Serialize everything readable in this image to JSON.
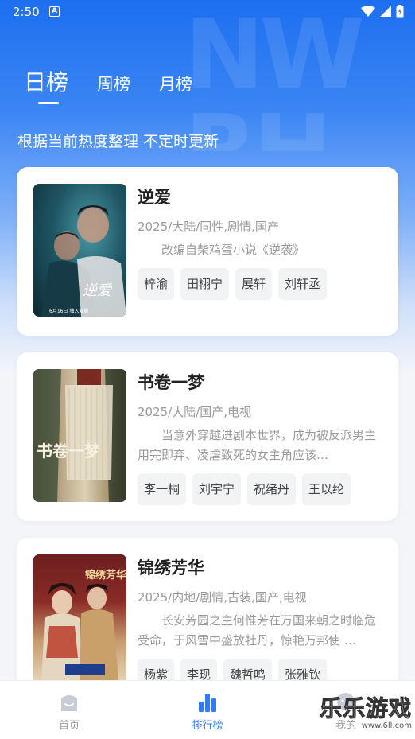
{
  "status_bar": {
    "time": "2:50",
    "a_badge": "A"
  },
  "tabs": [
    {
      "label": "日榜",
      "active": true
    },
    {
      "label": "周榜",
      "active": false
    },
    {
      "label": "月榜",
      "active": false
    }
  ],
  "subtitle": "根据当前热度整理 不定时更新",
  "items": [
    {
      "title": "逆爱",
      "meta": "2025/大陆/同性,剧情,国产",
      "desc": "改编自柴鸡蛋小说《逆袭》",
      "tags": [
        "梓渝",
        "田栩宁",
        "展轩",
        "刘轩丞"
      ],
      "poster_text": "逆爱",
      "poster_date": "6月16日 独入爱影"
    },
    {
      "title": "书卷一梦",
      "meta": "2025/大陆/国产,电视",
      "desc": "当意外穿越进剧本世界，成为被反派男主用完即弃、凌虐致死的女主角应该…",
      "tags": [
        "李一桐",
        "刘宇宁",
        "祝绪丹",
        "王以纶"
      ],
      "poster_text": "书卷一梦"
    },
    {
      "title": "锦绣芳华",
      "meta": "2025/内地/剧情,古装,国产,电视",
      "desc": "长安芳园之主何惟芳在万国来朝之时临危受命，于风雪中盛放牡丹，惊艳万邦使 …",
      "tags": [
        "杨紫",
        "李现",
        "魏哲鸣",
        "张雅钦"
      ],
      "poster_text": "锦绣芳华"
    }
  ],
  "bottom_nav": [
    {
      "label": "首页",
      "icon": "home-icon",
      "active": false
    },
    {
      "label": "排行榜",
      "icon": "bar-chart-icon",
      "active": true
    },
    {
      "label": "我的",
      "icon": "profile-icon",
      "active": false
    }
  ],
  "watermark": {
    "main": "乐乐游戏",
    "url": "www.6ll.com"
  },
  "colors": {
    "accent": "#2f7cf6",
    "hero_top": "#1d6ff0"
  }
}
